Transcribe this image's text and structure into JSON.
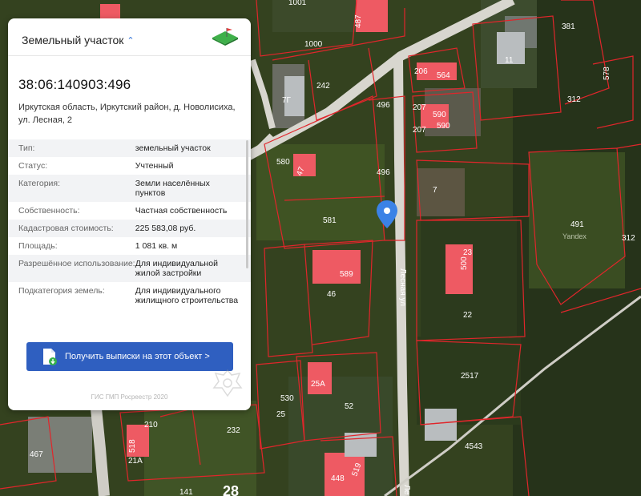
{
  "panel": {
    "title": "Земельный участок",
    "cadastral_number": "38:06:140903:496",
    "address": "Иркутская область, Иркутский район, д. Новолисиха, ул. Лесная, 2",
    "properties": [
      {
        "key": "Тип:",
        "value": "земельный участок"
      },
      {
        "key": "Статус:",
        "value": "Учтенный"
      },
      {
        "key": "Категория:",
        "value": "Земли населённых пунктов"
      },
      {
        "key": "Собственность:",
        "value": "Частная собственность"
      },
      {
        "key": "Кадастровая стоимость:",
        "value": "225 583,08 руб."
      },
      {
        "key": "Площадь:",
        "value": "1 081 кв. м"
      },
      {
        "key": "Разрешённое использование:",
        "value": "Для индивидуальной жилой застройки"
      },
      {
        "key": "Подкатегория земель:",
        "value": "Для индивидуального жилищного строительства"
      }
    ],
    "button_label": "Получить выписки на этот объект >",
    "footer": "ГИС ГМП Росреестр 2020",
    "icons": {
      "header": "land-plot-icon",
      "chevron": "chevron-up-icon",
      "button": "document-download-icon",
      "footer": "emblem-icon"
    }
  },
  "map": {
    "marker_icon": "map-pin-icon",
    "road_name": "Лесная ул",
    "road_name_short": "Ле",
    "watermark": "Yandex",
    "parcel_labels": [
      "1001",
      "487",
      "381",
      "1000",
      "11",
      "206",
      "564",
      "578",
      "242",
      "7Г",
      "496",
      "207",
      "590",
      "312",
      "207",
      "590",
      "580",
      "47",
      "496",
      "7",
      "491",
      "581",
      "312",
      "589",
      "500",
      "23",
      "46",
      "22",
      "2517",
      "25А",
      "530",
      "52",
      "25",
      "210",
      "518",
      "232",
      "21А",
      "467",
      "448",
      "519",
      "4543",
      "141",
      "28"
    ],
    "colors": {
      "parcel_border": "#e0262b",
      "roof": "#ee5a63",
      "road": "#d8d6cf",
      "pin": "#3b82e6"
    }
  }
}
